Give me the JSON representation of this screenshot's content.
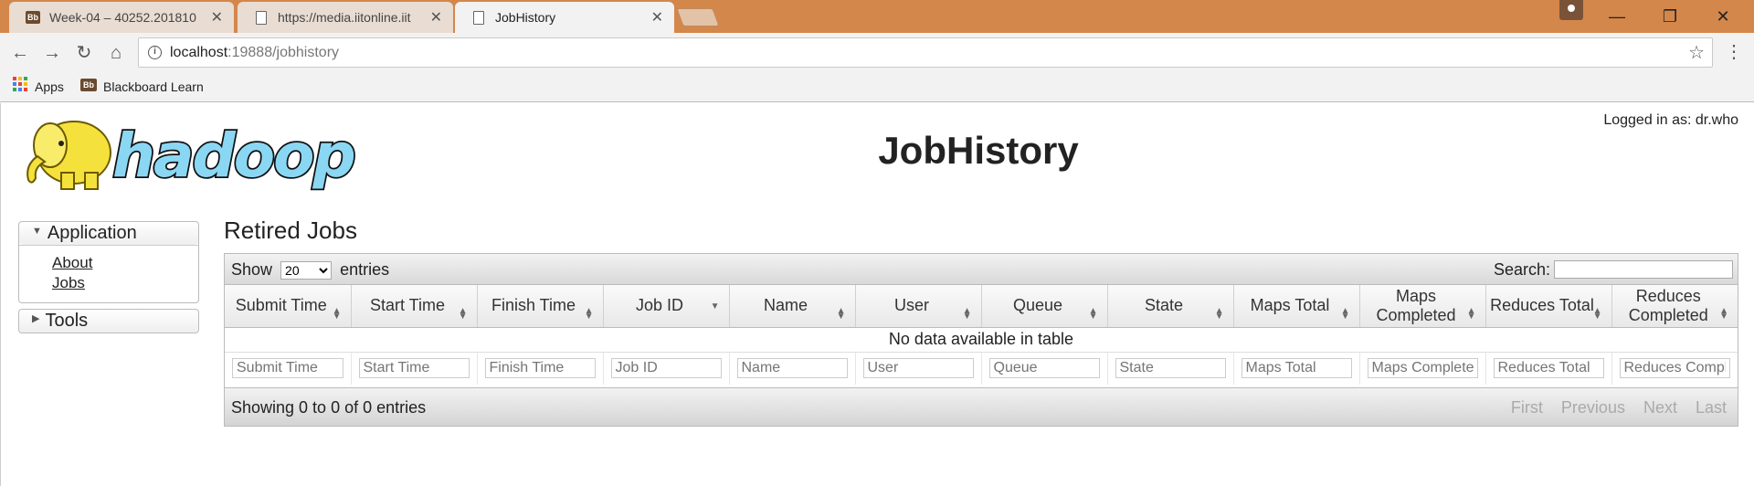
{
  "browser": {
    "tabs": [
      {
        "title": "Week-04 – 40252.201810",
        "icon": "blackboard-favicon",
        "favicon_text": "Bb"
      },
      {
        "title": "https://media.iitonline.iit",
        "icon": "document-favicon"
      },
      {
        "title": "JobHistory",
        "icon": "document-favicon",
        "active": true
      }
    ],
    "url_host": "localhost",
    "url_path": ":19888/jobhistory",
    "bookmarks": [
      {
        "label": "Apps",
        "icon": "apps-grid-icon"
      },
      {
        "label": "Blackboard Learn",
        "icon": "blackboard-favicon",
        "favicon_text": "Bb"
      }
    ]
  },
  "header": {
    "logo_text": "hadoop",
    "title": "JobHistory",
    "logged_in": "Logged in as: dr.who"
  },
  "sidebar": {
    "application": {
      "label": "Application",
      "links": [
        "About",
        "Jobs"
      ]
    },
    "tools": {
      "label": "Tools"
    }
  },
  "main": {
    "section_title": "Retired Jobs",
    "show_label": "Show",
    "page_size": "20",
    "entries_label": "entries",
    "search_label": "Search:",
    "columns": [
      "Submit Time",
      "Start Time",
      "Finish Time",
      "Job ID",
      "Name",
      "User",
      "Queue",
      "State",
      "Maps Total",
      "Maps Completed",
      "Reduces Total",
      "Reduces Completed"
    ],
    "empty_message": "No data available in table",
    "filter_placeholders": [
      "Submit Time",
      "Start Time",
      "Finish Time",
      "Job ID",
      "Name",
      "User",
      "Queue",
      "State",
      "Maps Total",
      "Maps Completed",
      "Reduces Total",
      "Reduces Comple"
    ],
    "info": "Showing 0 to 0 of 0 entries",
    "pager": [
      "First",
      "Previous",
      "Next",
      "Last"
    ]
  },
  "colors": {
    "titlebar": "#d4874b",
    "hadoop_yellow": "#f5e13c",
    "hadoop_blue": "#8ad7f4"
  }
}
